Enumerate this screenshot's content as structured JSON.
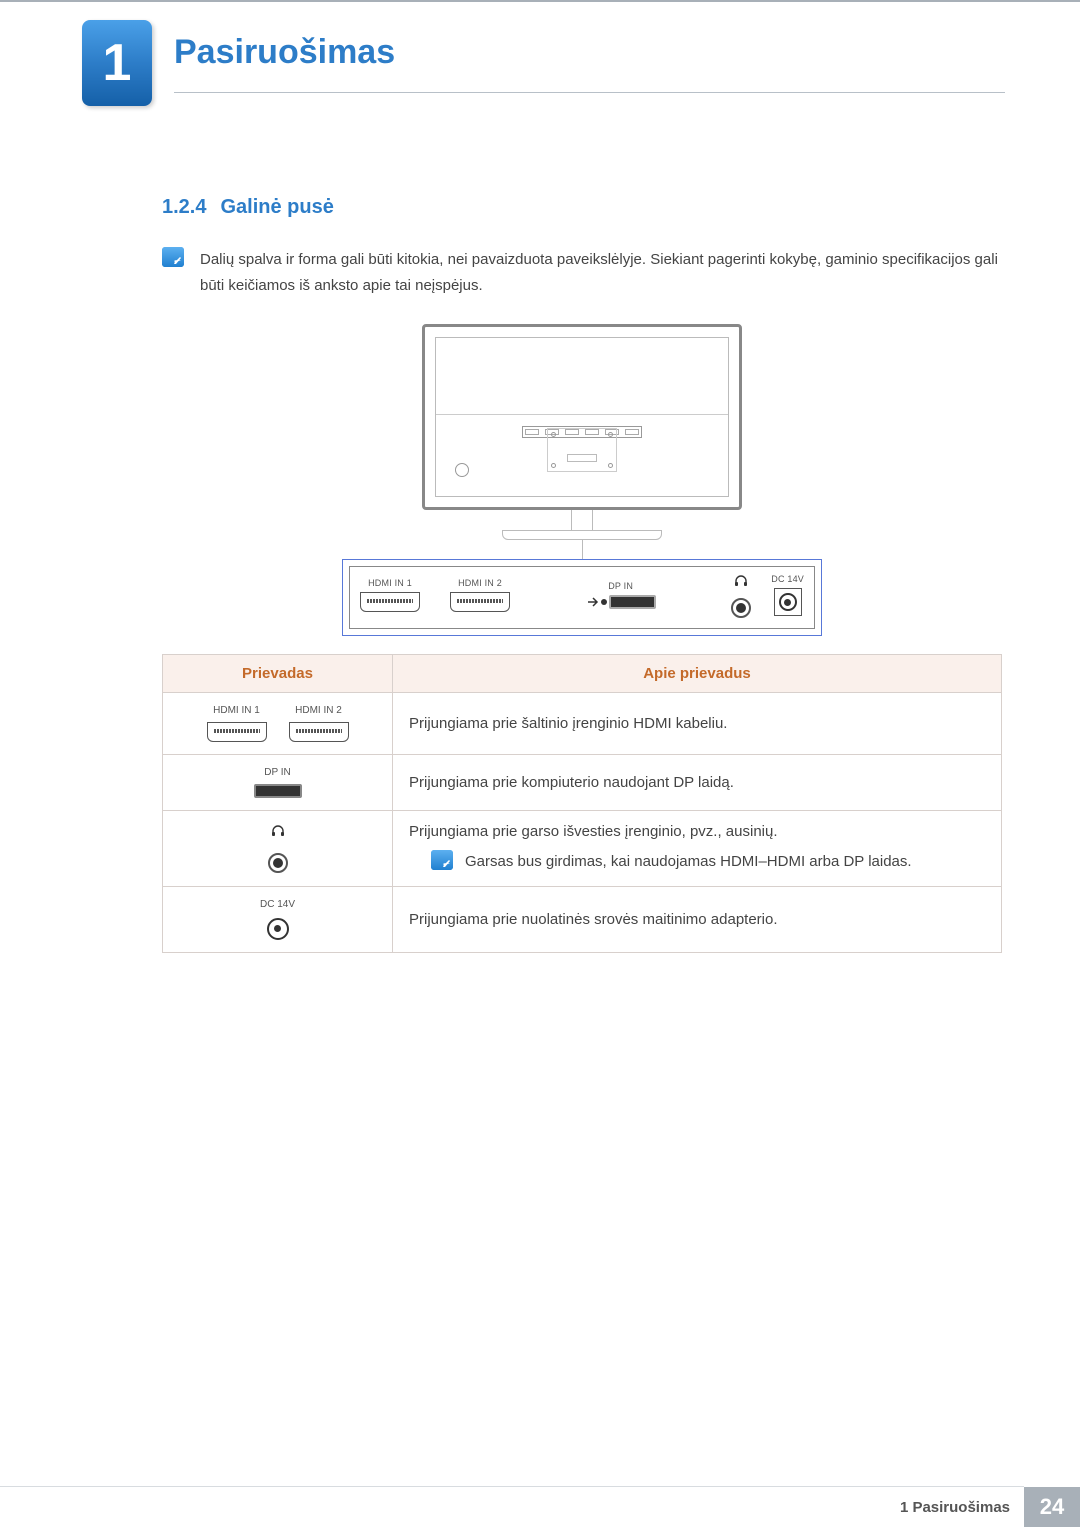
{
  "header": {
    "chapter_number": "1",
    "chapter_title": "Pasiruošimas"
  },
  "subsection": {
    "number": "1.2.4",
    "title": "Galinė pusė"
  },
  "intro_note": "Dalių spalva ir forma gali būti kitokia, nei pavaizduota paveikslėlyje. Siekiant pagerinti kokybę, gaminio specifikacijos gali būti keičiamos iš anksto apie tai neįspėjus.",
  "panel_labels": {
    "hdmi1": "HDMI IN 1",
    "hdmi2": "HDMI IN 2",
    "dp": "DP IN",
    "dc": "DC 14V"
  },
  "table": {
    "header_port": "Prievadas",
    "header_desc": "Apie prievadus",
    "rows": [
      {
        "desc": "Prijungiama prie šaltinio įrenginio HDMI kabeliu."
      },
      {
        "desc": "Prijungiama prie kompiuterio naudojant DP laidą."
      },
      {
        "desc": "Prijungiama prie garso išvesties įrenginio, pvz., ausinių.",
        "note": "Garsas bus girdimas, kai naudojamas HDMI–HDMI arba DP laidas."
      },
      {
        "desc": "Prijungiama prie nuolatinės srovės maitinimo adapterio."
      }
    ]
  },
  "footer": {
    "text": "1 Pasiruošimas",
    "page": "24"
  }
}
